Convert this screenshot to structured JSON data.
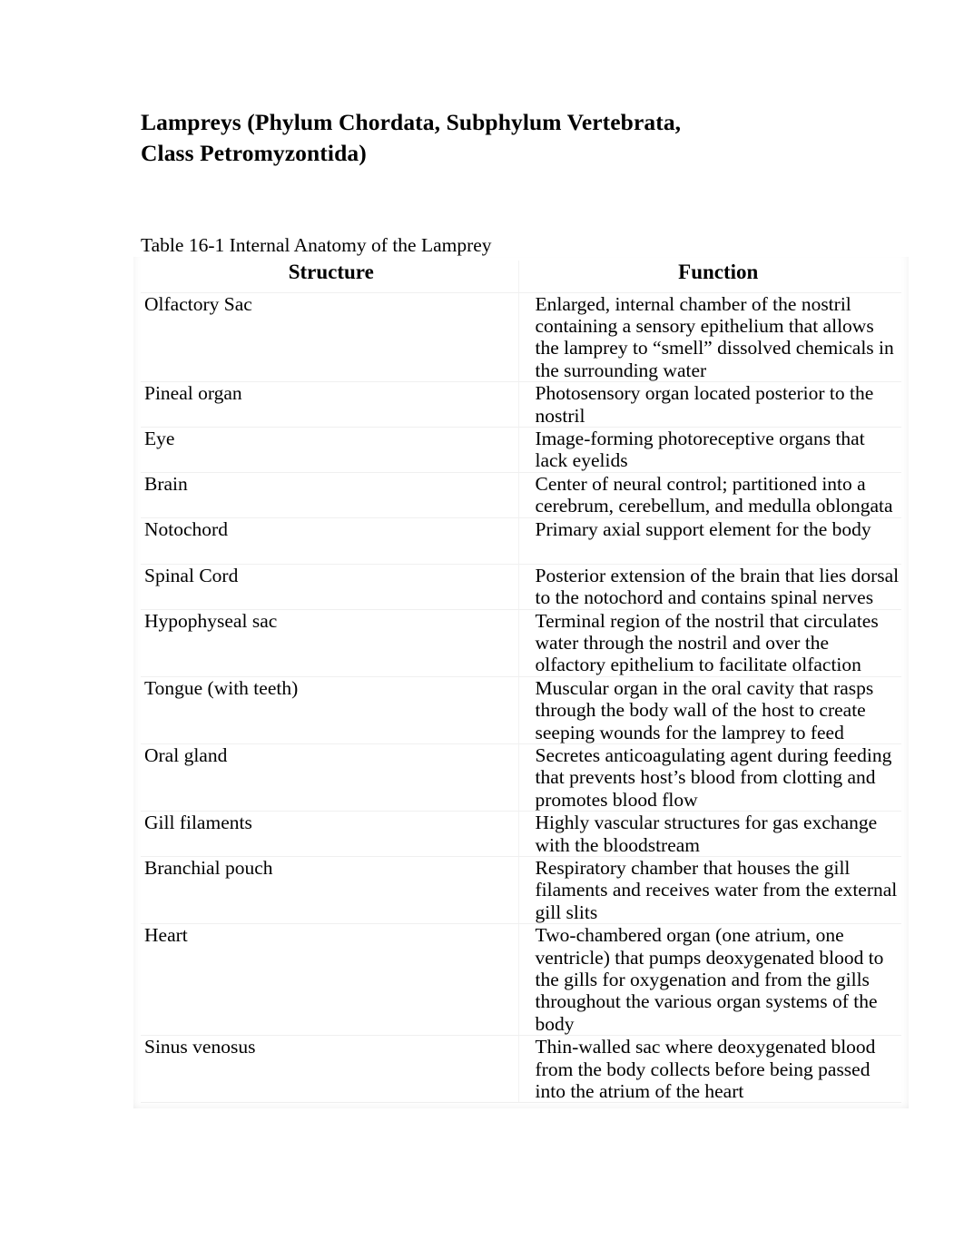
{
  "document": {
    "title": "Lampreys (Phylum Chordata, Subphylum Vertebrata, Class Petromyzontida)",
    "table_caption": "Table 16-1 Internal Anatomy of the Lamprey",
    "background_color": "#ffffff",
    "text_color": "#000000",
    "separator_color": "#f0f0f0"
  },
  "table": {
    "columns": [
      "Structure",
      "Function"
    ],
    "rows": [
      {
        "structure": "Olfactory Sac",
        "function": "Enlarged, internal chamber of the nostril containing a sensory epithelium that allows the lamprey to “smell” dissolved chemicals in the surrounding water"
      },
      {
        "structure": "Pineal organ",
        "function": "Photosensory organ located posterior to the nostril"
      },
      {
        "structure": "Eye",
        "function": "Image-forming photoreceptive organs that lack eyelids"
      },
      {
        "structure": "Brain",
        "function": "Center of neural control; partitioned into a cerebrum, cerebellum, and medulla oblongata"
      },
      {
        "structure": "Notochord",
        "function": "Primary axial support element for the body"
      },
      {
        "structure": "Spinal Cord",
        "function": "Posterior extension of the brain that lies dorsal to the notochord and contains spinal nerves"
      },
      {
        "structure": "Hypophyseal sac",
        "function": "Terminal region of the nostril that circulates water through the nostril and over the olfactory epithelium to facilitate olfaction"
      },
      {
        "structure": "Tongue (with teeth)",
        "function": "Muscular organ in the oral cavity that rasps through the body wall of the host to create seeping wounds for the lamprey to feed"
      },
      {
        "structure": "Oral gland",
        "function": "Secretes anticoagulating agent during feeding that prevents host’s blood from clotting and promotes blood flow"
      },
      {
        "structure": "Gill filaments",
        "function": "Highly vascular structures for gas exchange with the bloodstream"
      },
      {
        "structure": "Branchial pouch",
        "function": "Respiratory chamber that houses the gill filaments and receives water from the external gill slits"
      },
      {
        "structure": "Heart",
        "function": "Two-chambered organ (one atrium, one ventricle) that pumps deoxygenated blood to the gills for oxygenation and from the gills throughout the various organ systems of the body"
      },
      {
        "structure": "Sinus venosus",
        "function": "Thin-walled sac where deoxygenated blood from the body collects before being passed into the atrium of the heart"
      }
    ]
  }
}
